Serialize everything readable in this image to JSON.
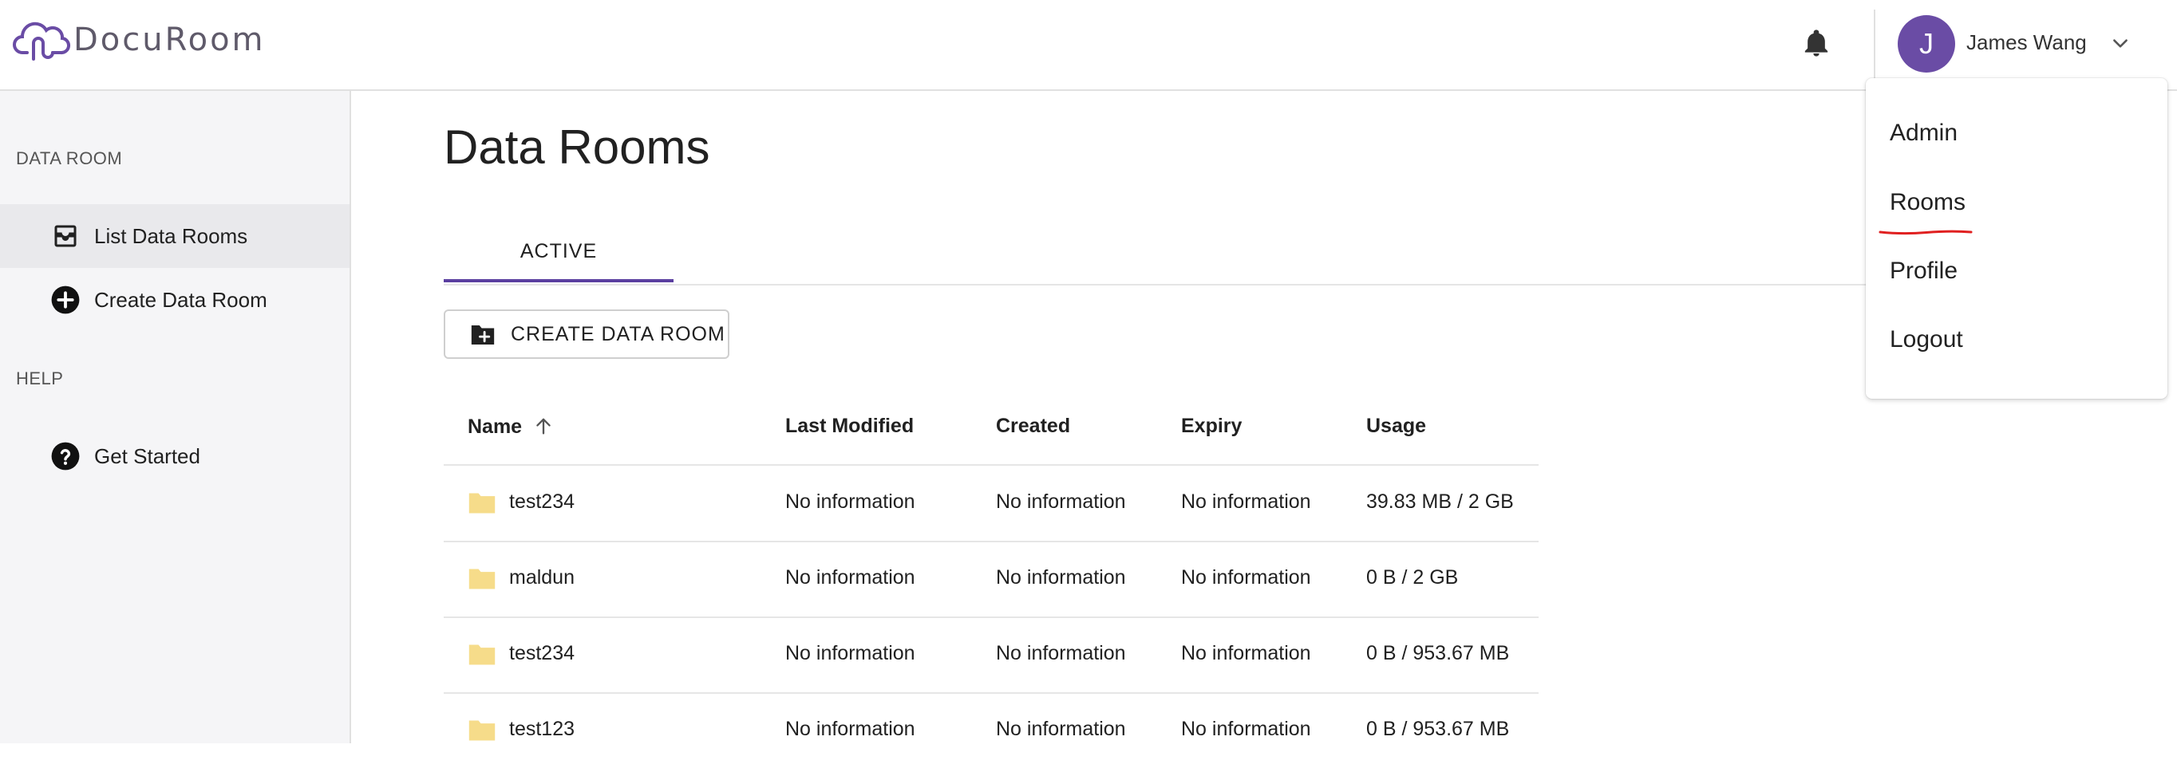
{
  "app": {
    "name": "DocuRoom"
  },
  "header": {
    "user_initial": "J",
    "user_name": "James Wang"
  },
  "sidebar": {
    "sections": [
      {
        "title": "DATA ROOM"
      },
      {
        "title": "HELP"
      }
    ],
    "items": [
      {
        "label": "List Data Rooms",
        "icon": "inbox-icon",
        "active": true
      },
      {
        "label": "Create Data Room",
        "icon": "add-circle-icon"
      },
      {
        "label": "Get Started",
        "icon": "help-circle-icon"
      }
    ]
  },
  "main": {
    "title": "Data Rooms",
    "tabs": [
      {
        "label": "ACTIVE",
        "selected": true
      }
    ],
    "create_button": "CREATE DATA ROOM",
    "table": {
      "columns": [
        "Name",
        "Last Modified",
        "Created",
        "Expiry",
        "Usage"
      ],
      "sort": {
        "column": "Name",
        "direction": "asc"
      },
      "rows": [
        {
          "name": "test234",
          "last_modified": "No information",
          "created": "No information",
          "expiry": "No information",
          "usage": "39.83 MB / 2 GB"
        },
        {
          "name": "maldun",
          "last_modified": "No information",
          "created": "No information",
          "expiry": "No information",
          "usage": "0 B / 2 GB"
        },
        {
          "name": "test234",
          "last_modified": "No information",
          "created": "No information",
          "expiry": "No information",
          "usage": "0 B / 953.67 MB"
        },
        {
          "name": "test123",
          "last_modified": "No information",
          "created": "No information",
          "expiry": "No information",
          "usage": "0 B / 953.67 MB"
        }
      ]
    }
  },
  "user_menu": {
    "items": [
      "Admin",
      "Rooms",
      "Profile",
      "Logout"
    ],
    "highlighted": "Rooms"
  },
  "colors": {
    "accent": "#5b3fa0",
    "avatar": "#6a4ca5",
    "folder": "#f6dc8a",
    "annotation": "#e02020"
  }
}
